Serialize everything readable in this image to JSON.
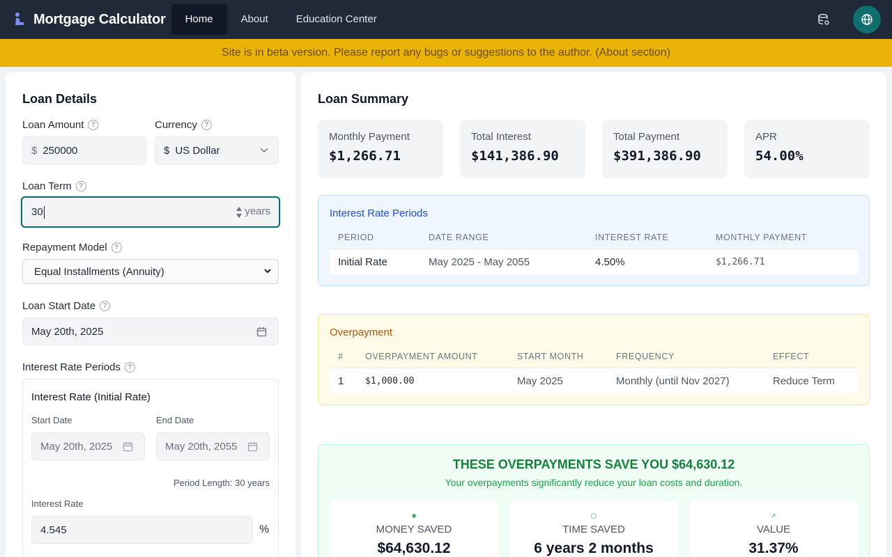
{
  "app": {
    "title": "Mortgage Calculator",
    "nav": [
      {
        "label": "Home",
        "active": true
      },
      {
        "label": "About",
        "active": false
      },
      {
        "label": "Education Center",
        "active": false
      }
    ],
    "icons": {
      "database": "database-settings-icon",
      "language": "globe-icon"
    },
    "colors": {
      "nav_bg": "#1f2937",
      "banner_bg": "#eab308",
      "accent_teal": "#0f6e6e"
    }
  },
  "banner": {
    "text": "Site is in beta version. Please report any bugs or suggestions to the author. (About section)"
  },
  "loan_details": {
    "title": "Loan Details",
    "loan_amount": {
      "label": "Loan Amount",
      "prefix": "$",
      "value": "250000"
    },
    "currency": {
      "label": "Currency",
      "prefix": "$",
      "value": "US Dollar"
    },
    "loan_term": {
      "label": "Loan Term",
      "value": "30",
      "suffix": "years"
    },
    "repayment_model": {
      "label": "Repayment Model",
      "value": "Equal Installments (Annuity)"
    },
    "start_date": {
      "label": "Loan Start Date",
      "value": "May 20th, 2025"
    },
    "interest_periods": {
      "label": "Interest Rate Periods",
      "card_title": "Interest Rate (Initial Rate)",
      "start_label": "Start Date",
      "start_value": "May 20th, 2025",
      "end_label": "End Date",
      "end_value": "May 20th, 2055",
      "period_length": "Period Length: 30 years",
      "rate_label": "Interest Rate",
      "rate_value": "4.545",
      "rate_suffix": "%"
    }
  },
  "loan_summary": {
    "title": "Loan Summary",
    "cards": [
      {
        "label": "Monthly Payment",
        "value": "$1,266.71"
      },
      {
        "label": "Total Interest",
        "value": "$141,386.90"
      },
      {
        "label": "Total Payment",
        "value": "$391,386.90"
      },
      {
        "label": "APR",
        "value": "54.00%"
      }
    ]
  },
  "interest_rate_periods_table": {
    "title": "Interest Rate Periods",
    "headers": [
      "PERIOD",
      "DATE RANGE",
      "INTEREST RATE",
      "MONTHLY PAYMENT"
    ],
    "rows": [
      {
        "period": "Initial Rate",
        "date_range": "May 2025 - May 2055",
        "rate": "4.50%",
        "payment": "$1,266.71"
      }
    ]
  },
  "overpayment_table": {
    "title": "Overpayment",
    "headers": [
      "#",
      "OVERPAYMENT AMOUNT",
      "START MONTH",
      "FREQUENCY",
      "EFFECT"
    ],
    "rows": [
      {
        "index": "1",
        "amount": "$1,000.00",
        "start_month": "May 2025",
        "frequency": "Monthly (until Nov 2027)",
        "effect": "Reduce Term"
      }
    ]
  },
  "savings": {
    "headline": "THESE OVERPAYMENTS SAVE YOU $64,630.12",
    "subtext": "Your overpayments significantly reduce your loan costs and duration.",
    "stats": [
      {
        "label": "MONEY SAVED",
        "value": "$64,630.12",
        "icon": "dollar-circle-icon"
      },
      {
        "label": "TIME SAVED",
        "value": "6 years 2 months",
        "icon": "clock-icon"
      },
      {
        "label": "VALUE",
        "value": "31.37%",
        "icon": "trend-up-icon"
      }
    ]
  }
}
